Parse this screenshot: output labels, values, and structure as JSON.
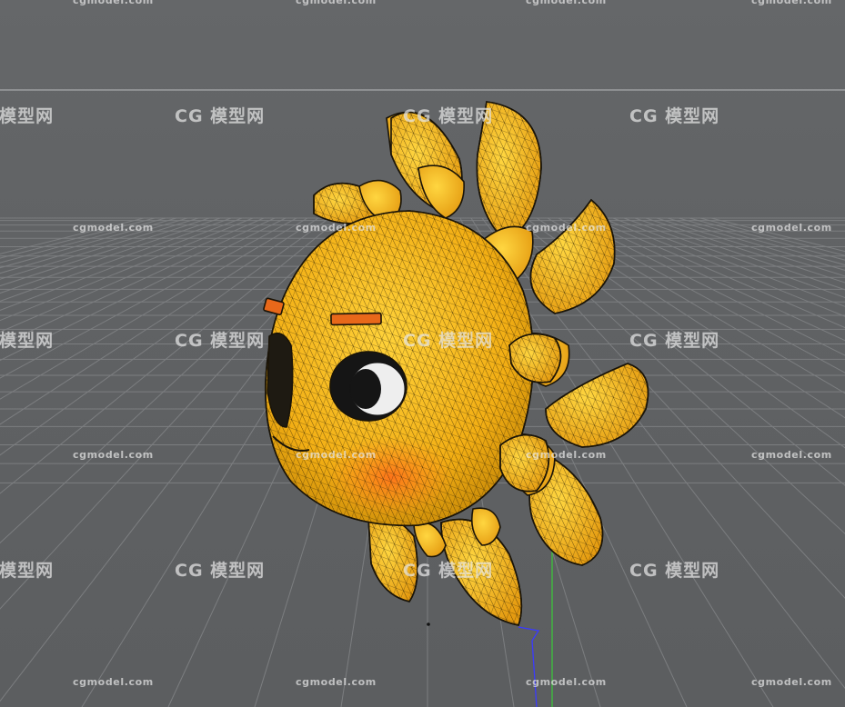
{
  "viewport": {
    "background": "#606264",
    "grid_color": "#7a7c7e",
    "horizon_color": "#8a8c8e",
    "model_color": "#f2b21a",
    "wire_color": "#1a1408",
    "axis_y_color": "#3cc23c",
    "axis_z_color": "#3a3aff"
  },
  "watermark": {
    "url": "cgmodel.com",
    "logo_mark": "CG",
    "logo_text": "模型网"
  }
}
